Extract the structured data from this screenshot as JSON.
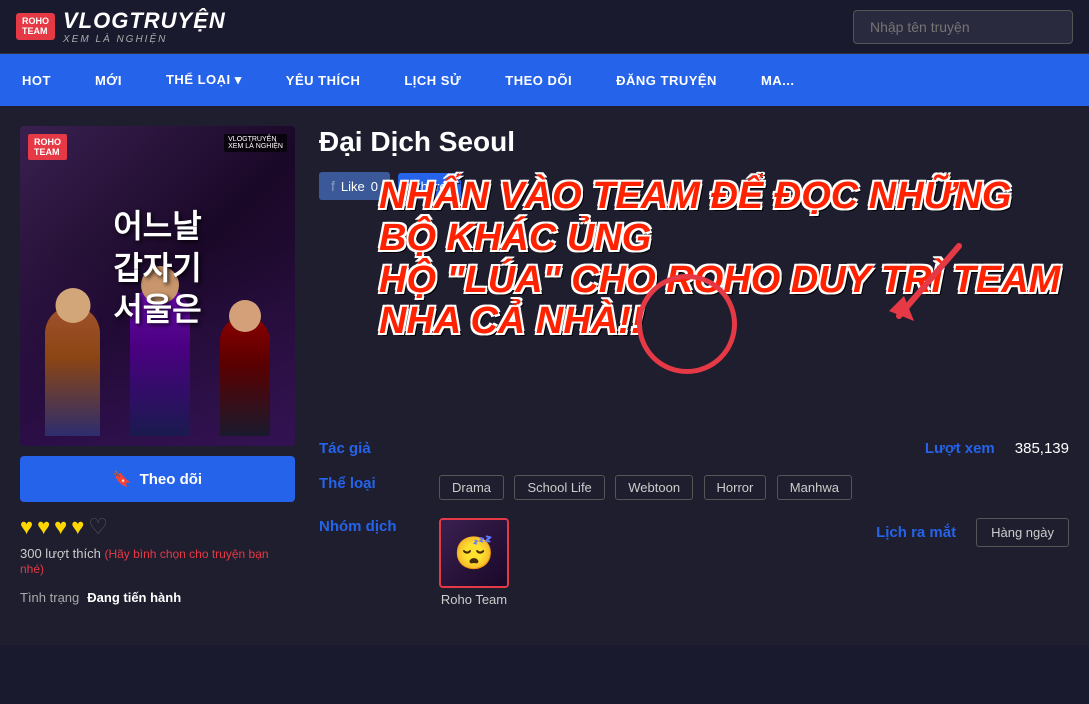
{
  "header": {
    "logo_main": "VLOGTRUYỆN",
    "logo_sub": "XEM LÀ NGHIỆN",
    "logo_tag": "ROHO\nTEAM",
    "search_placeholder": "Nhập tên truyện"
  },
  "nav": {
    "items": [
      {
        "label": "HOT",
        "arrow": false
      },
      {
        "label": "MỚI",
        "arrow": false
      },
      {
        "label": "THỂ LOẠI",
        "arrow": true
      },
      {
        "label": "YÊU THÍCH",
        "arrow": false
      },
      {
        "label": "LỊCH SỬ",
        "arrow": false
      },
      {
        "label": "THEO DÕI",
        "arrow": false
      },
      {
        "label": "ĐĂNG TRUYỆN",
        "arrow": false
      },
      {
        "label": "MA...",
        "arrow": false
      }
    ]
  },
  "manga": {
    "title": "Đại Dịch Seoul",
    "cover_title_kr": "어느날\n갑자기\n서울은",
    "like_count": "0",
    "like_label": "Like",
    "share_label": "Share",
    "overlay_line1": "NHẤN VÀO TEAM ĐỂ ĐỌC NHỮNG BỘ KHÁC ỦNG",
    "overlay_line2": "HỘ \"LÚA\" CHO ROHO DUY TRÌ TEAM NHA CẢ NHÀ!!",
    "author_label": "Tác giả",
    "author_value": "",
    "views_label": "Lượt xem",
    "views_value": "385,139",
    "genre_label": "Thể loại",
    "genres": [
      "Drama",
      "School Life",
      "Webtoon",
      "Horror",
      "Manhwa"
    ],
    "group_label": "Nhóm dịch",
    "group_name": "Roho Team",
    "schedule_label": "Lịch ra mắt",
    "schedule_value": "Hàng ngày",
    "follow_label": "Theo dõi",
    "rating_count": "300 lượt thích",
    "rating_prompt": "(Hãy bình chọn cho truyện bạn nhé)",
    "status_label": "Tình trạng",
    "status_value": "Đang tiến hành"
  }
}
